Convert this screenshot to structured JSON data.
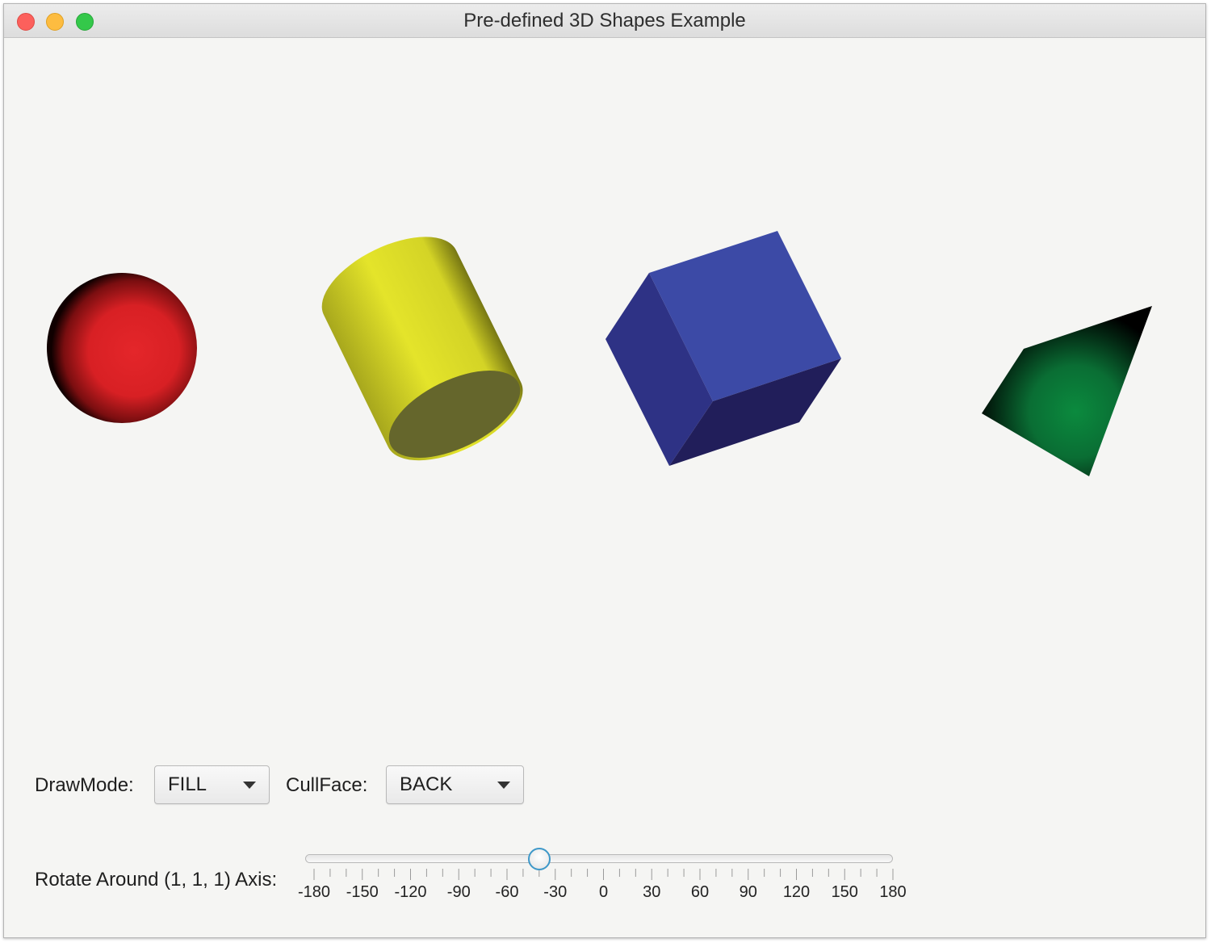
{
  "window": {
    "title": "Pre-defined 3D Shapes Example"
  },
  "shapes": [
    {
      "kind": "sphere",
      "color": "#e02424"
    },
    {
      "kind": "cylinder",
      "color": "#e4e42a"
    },
    {
      "kind": "box",
      "color": "#3c4aa6"
    },
    {
      "kind": "mesh",
      "color": "#0a8a3c"
    }
  ],
  "controls": {
    "draw_mode_label": "DrawMode:",
    "draw_mode_value": "FILL",
    "cull_face_label": "CullFace:",
    "cull_face_value": "BACK",
    "rotate_label": "Rotate Around (1, 1, 1) Axis:",
    "slider": {
      "min": -180,
      "max": 180,
      "value": -40,
      "major_ticks": [
        "-180",
        "-150",
        "-120",
        "-90",
        "-60",
        "-30",
        "0",
        "30",
        "60",
        "90",
        "120",
        "150",
        "180"
      ]
    }
  },
  "colors": {
    "accent": "#3e98c9",
    "window_bg": "#f5f5f3"
  }
}
